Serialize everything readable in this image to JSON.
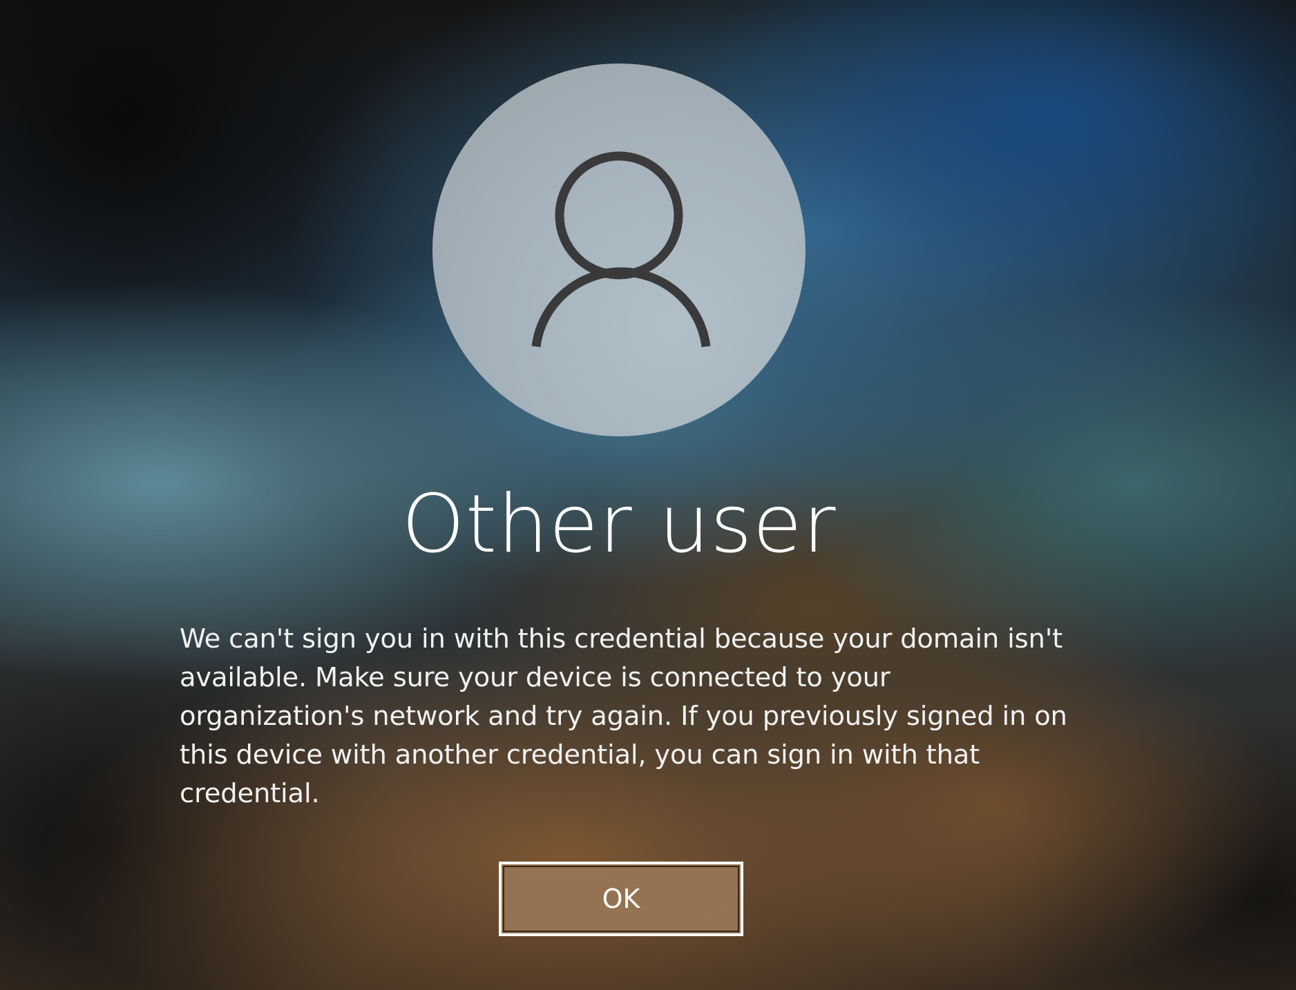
{
  "user_tile": {
    "icon": "person-outline-icon",
    "name": "Other user"
  },
  "message": {
    "text": "We can't sign you in with this credential because your domain isn't available. Make sure your device is connected to your organization's network and try again. If you previously signed in on this device with another credential, you can sign in with that credential."
  },
  "ok_button": {
    "label": "OK"
  },
  "colors": {
    "avatar_bg": "#a9b6bf",
    "icon_stroke": "#3a3a3a",
    "button_bg": "#987656",
    "text": "#ffffff"
  }
}
